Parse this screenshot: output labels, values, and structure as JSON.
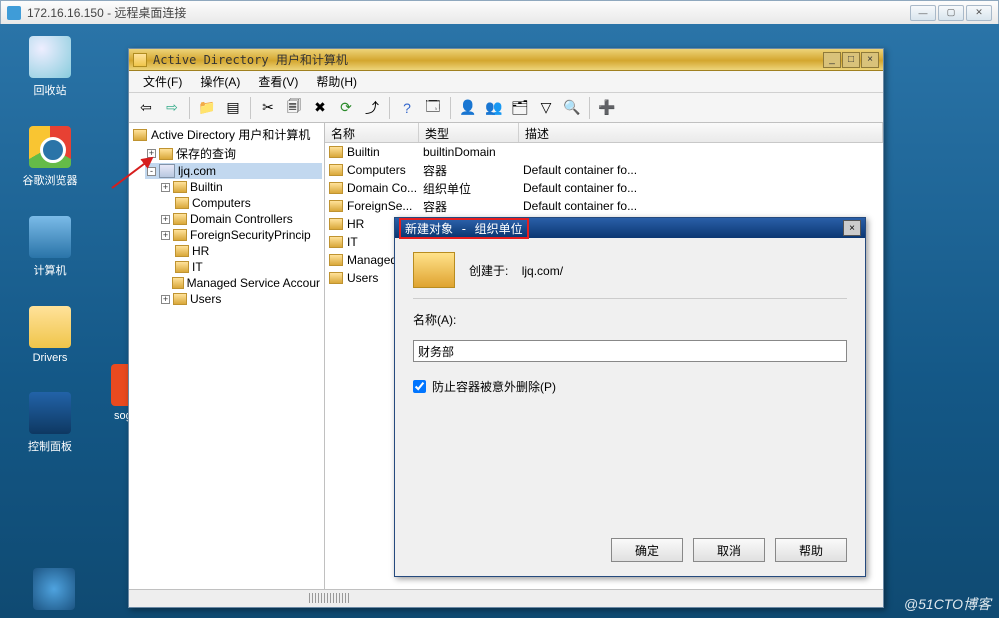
{
  "rdp": {
    "title": "172.16.16.150 - 远程桌面连接"
  },
  "desktop_icons": {
    "recycle": "回收站",
    "chrome": "谷歌浏览器",
    "pc": "计算机",
    "drivers": "Drivers",
    "sogou": "sogou_",
    "cp": "控制面板"
  },
  "ad_window": {
    "title": "Active Directory 用户和计算机",
    "menu": {
      "file": "文件(F)",
      "action": "操作(A)",
      "view": "查看(V)",
      "help": "帮助(H)"
    },
    "tree": {
      "root": "Active Directory 用户和计算机",
      "saved_queries": "保存的查询",
      "domain": "ljq.com",
      "children": [
        "Builtin",
        "Computers",
        "Domain Controllers",
        "ForeignSecurityPrincip",
        "HR",
        "IT",
        "Managed Service Accour",
        "Users"
      ]
    },
    "list": {
      "cols": {
        "name": "名称",
        "type": "类型",
        "desc": "描述"
      },
      "rows": [
        {
          "name": "Builtin",
          "type": "builtinDomain",
          "desc": ""
        },
        {
          "name": "Computers",
          "type": "容器",
          "desc": "Default container fo..."
        },
        {
          "name": "Domain Co...",
          "type": "组织单位",
          "desc": "Default container fo..."
        },
        {
          "name": "ForeignSe...",
          "type": "容器",
          "desc": "Default container fo..."
        },
        {
          "name": "HR",
          "type": "",
          "desc": ""
        },
        {
          "name": "IT",
          "type": "",
          "desc": ""
        },
        {
          "name": "Managed S...",
          "type": "",
          "desc": ""
        },
        {
          "name": "Users",
          "type": "",
          "desc": ""
        }
      ]
    }
  },
  "dialog": {
    "title": "新建对象 - 组织单位",
    "created_in_label": "创建于:",
    "created_in_value": "ljq.com/",
    "name_label": "名称(A):",
    "name_value": "财务部",
    "protect_label": "防止容器被意外删除(P)",
    "buttons": {
      "ok": "确定",
      "cancel": "取消",
      "help": "帮助"
    }
  },
  "watermark": "@51CTO博客"
}
